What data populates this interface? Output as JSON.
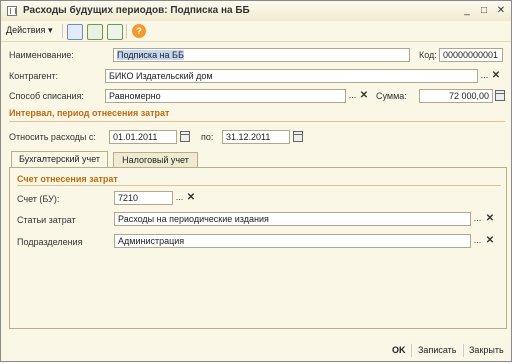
{
  "window": {
    "title": "Расходы будущих периодов: Подписка на ББ"
  },
  "toolbar": {
    "actions_label": "Действия",
    "actions_arrow": "▾"
  },
  "form": {
    "name_label": "Наименование:",
    "name_value": "Подписка на ББ",
    "code_label": "Код:",
    "code_value": "00000000001",
    "contractor_label": "Контрагент:",
    "contractor_value": "БИКО Издательский дом",
    "method_label": "Способ списания:",
    "method_value": "Равномерно",
    "sum_label": "Сумма:",
    "sum_value": "72 000,00"
  },
  "interval": {
    "title": "Интервал, период отнесения затрат",
    "from_label": "Относить расходы с:",
    "from_value": "01.01.2011",
    "to_label": "по:",
    "to_value": "31.12.2011"
  },
  "tabs": [
    {
      "label": "Бухгалтерский учет"
    },
    {
      "label": "Налоговый учет"
    }
  ],
  "accounting": {
    "section_title": "Счет отнесения затрат",
    "account_label": "Счет (БУ):",
    "account_value": "7210",
    "cost_items_label": "Статьи затрат",
    "cost_items_value": "Расходы на периодические издания",
    "department_label": "Подразделения",
    "department_value": "Администрация"
  },
  "footer": {
    "ok": "OK",
    "save": "Записать",
    "close": "Закрыть"
  },
  "common": {
    "ellipsis": "...",
    "clear": "✕"
  },
  "colors": {
    "accent_section": "#c06a10",
    "background": "#fbf7e6",
    "selection": "#c6d7f2"
  }
}
